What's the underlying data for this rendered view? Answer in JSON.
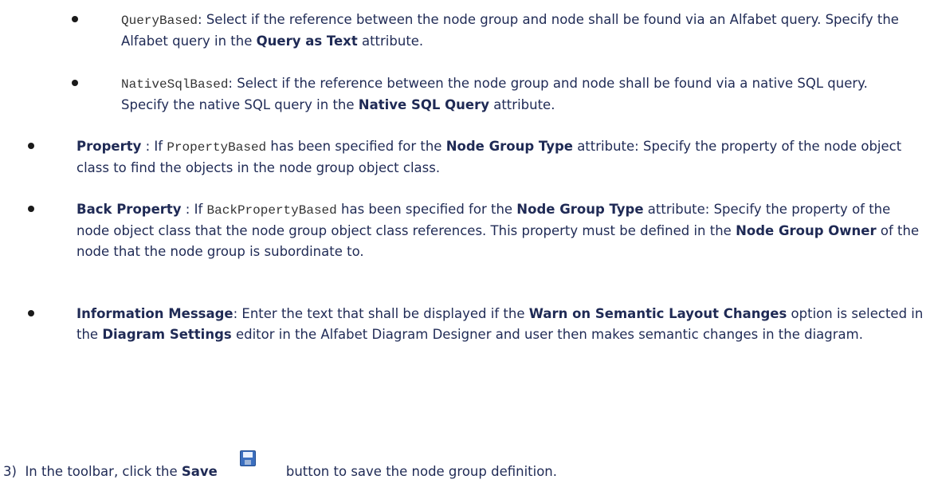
{
  "sub_bullets": [
    {
      "code": "QueryBased",
      "text1": ": Select if the reference between the node group and node shall be found via an Alfabet query. Specify the Alfabet query in the ",
      "bold1": "Query as Text",
      "text2": " attribute."
    },
    {
      "code": "NativeSqlBased",
      "text1": ": Select if the reference between the node group and node shall be found via a native SQL query. Specify the native SQL query in the ",
      "bold1": "Native SQL Query",
      "text2": " attribute."
    }
  ],
  "property": {
    "term": "Property",
    "t1": " : If ",
    "code": "PropertyBased",
    "t2": " has been specified for the ",
    "bold": "Node Group Type",
    "t3": " attribute: Specify the property of the node object class to find the objects in the node group object class."
  },
  "back_property": {
    "term": "Back Property",
    "t1": " : If ",
    "code": "BackPropertyBased",
    "t2": " has been specified for the ",
    "bold1": "Node Group Type",
    "t3": " attribute: Specify the property of the node object class that the node group object class references. This property must be defined in the ",
    "bold2": "Node Group Owner",
    "t4": " of the node that the node group is subordinate to."
  },
  "info_message": {
    "term": "Information Message",
    "t1": ": Enter the text that shall be displayed if the ",
    "bold1": "Warn on Semantic Layout Changes",
    "t2": " option is selected in the ",
    "bold2": "Diagram Settings",
    "t3": " editor in the Alfabet Diagram Designer and user then makes semantic changes in the diagram."
  },
  "step3": {
    "number": "3)",
    "t1": "In the toolbar, click the ",
    "bold": "Save",
    "icon": "save-icon",
    "t2": "button to save the node group definition."
  }
}
